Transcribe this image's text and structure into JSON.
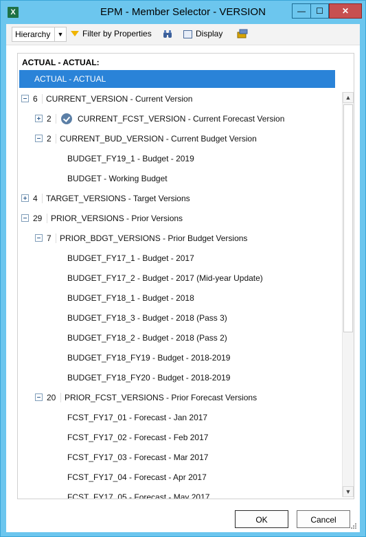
{
  "window": {
    "title": "EPM - Member Selector - VERSION",
    "app_icon": "X",
    "minimize_glyph": "—",
    "maximize_glyph": "☐",
    "close_glyph": "✕"
  },
  "toolbar": {
    "hierarchy_label": "Hierarchy",
    "hierarchy_arrow": "▼",
    "filter_label": "Filter by Properties",
    "display_label": "Display",
    "icons": [
      "funnel-icon",
      "binoculars-icon",
      "display-icon",
      "properties-icon"
    ]
  },
  "selection": {
    "label": "ACTUAL - ACTUAL:"
  },
  "tree": {
    "rows": [
      {
        "text": "ACTUAL - ACTUAL",
        "selected": true
      },
      {
        "count": "6",
        "text": "CURRENT_VERSION - Current Version",
        "expander": "collapse"
      },
      {
        "count": "2",
        "text": "CURRENT_FCST_VERSION - Current Forecast Version",
        "expander": "expand",
        "checked": true
      },
      {
        "count": "2",
        "text": "CURRENT_BUD_VERSION - Current Budget Version",
        "expander": "collapse"
      },
      {
        "text": "BUDGET_FY19_1 - Budget - 2019"
      },
      {
        "text": "BUDGET - Working Budget"
      },
      {
        "count": "4",
        "text": "TARGET_VERSIONS - Target Versions",
        "expander": "expand"
      },
      {
        "count": "29",
        "text": "PRIOR_VERSIONS - Prior Versions",
        "expander": "collapse"
      },
      {
        "count": "7",
        "text": "PRIOR_BDGT_VERSIONS - Prior Budget Versions",
        "expander": "collapse"
      },
      {
        "text": "BUDGET_FY17_1 - Budget - 2017"
      },
      {
        "text": "BUDGET_FY17_2 - Budget - 2017 (Mid-year Update)"
      },
      {
        "text": "BUDGET_FY18_1 - Budget - 2018"
      },
      {
        "text": "BUDGET_FY18_3 - Budget - 2018 (Pass 3)"
      },
      {
        "text": "BUDGET_FY18_2 - Budget - 2018 (Pass 2)"
      },
      {
        "text": "BUDGET_FY18_FY19 - Budget - 2018-2019"
      },
      {
        "text": "BUDGET_FY18_FY20 - Budget - 2018-2019"
      },
      {
        "count": "20",
        "text": "PRIOR_FCST_VERSIONS - Prior Forecast Versions",
        "expander": "collapse"
      },
      {
        "text": "FCST_FY17_01 - Forecast - Jan 2017"
      },
      {
        "text": "FCST_FY17_02 - Forecast - Feb 2017"
      },
      {
        "text": "FCST_FY17_03 - Forecast - Mar 2017"
      },
      {
        "text": "FCST_FY17_04 - Forecast - Apr 2017"
      },
      {
        "text": "FCST_FY17_05 - Forecast - May 2017"
      }
    ]
  },
  "scrollbar": {
    "up_glyph": "▲",
    "down_glyph": "▼"
  },
  "buttons": {
    "ok": "OK",
    "cancel": "Cancel"
  },
  "colors": {
    "titlebar": "#6cc6ee",
    "selection": "#2a83d8",
    "close": "#c75050"
  }
}
